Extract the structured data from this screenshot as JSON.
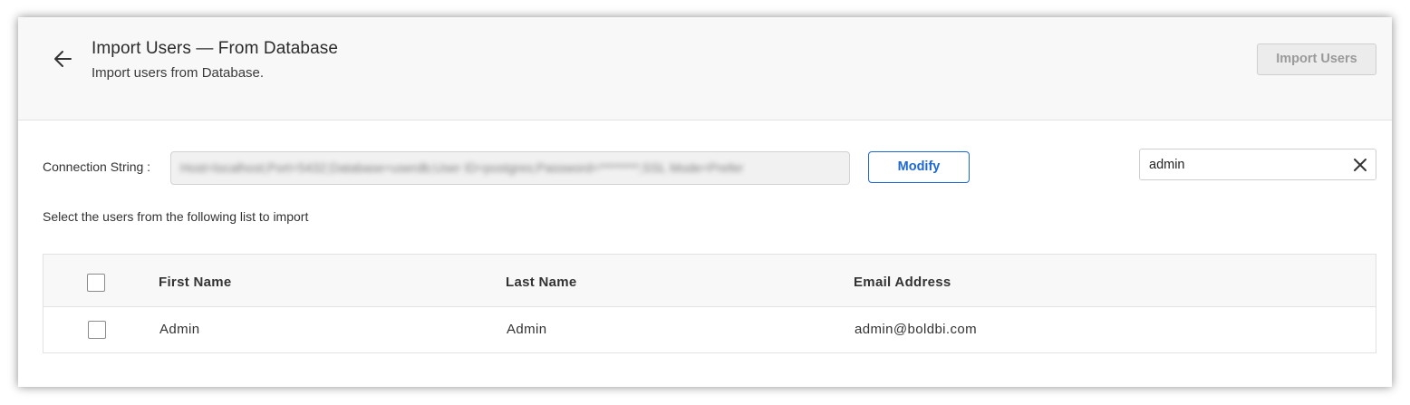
{
  "header": {
    "title": "Import Users — From Database",
    "subtitle": "Import users from Database.",
    "import_button_label": "Import Users",
    "back_icon": "arrow-left-icon"
  },
  "connection": {
    "label": "Connection String :",
    "value_obscured": "Host=localhost;Port=5432;Database=userdb;User ID=postgres;Password=********;SSL Mode=Prefer",
    "modify_label": "Modify"
  },
  "search": {
    "value": "admin",
    "clear_icon": "close-icon"
  },
  "instruction": "Select the users from the following list to import",
  "table": {
    "columns": [
      "First Name",
      "Last Name",
      "Email Address"
    ],
    "rows": [
      {
        "first_name": "Admin",
        "last_name": "Admin",
        "email": "admin@boldbi.com",
        "selected": false
      }
    ],
    "select_all": false
  },
  "colors": {
    "accent": "#1c69d4",
    "header_bg": "#f8f8f8",
    "disabled_text": "#9a9a9a"
  }
}
